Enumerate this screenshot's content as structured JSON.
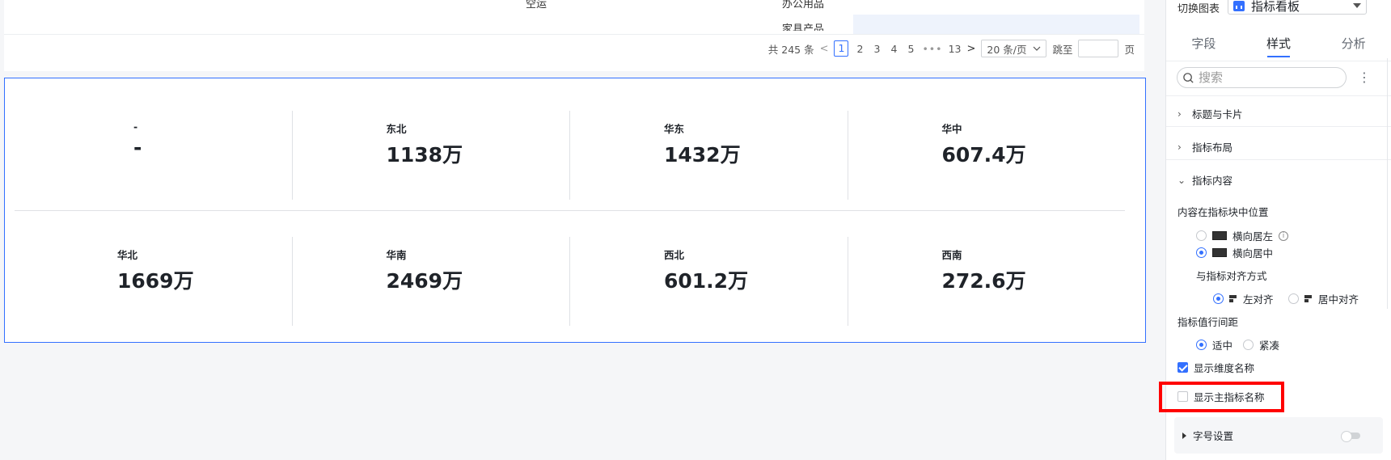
{
  "table": {
    "cut_cell_left": "空运",
    "cut_cell_right_1": "办公用品",
    "cut_cell_right_2": "家具产品"
  },
  "pagination": {
    "total": "共 245 条",
    "prev": "<",
    "pages": [
      "1",
      "2",
      "3",
      "4",
      "5"
    ],
    "ellipsis": "•••",
    "last_page": "13",
    "next": ">",
    "page_size": "20 条/页",
    "jump_label": "跳至",
    "jump_value": "",
    "page_suffix": "页"
  },
  "kpi": {
    "row1": [
      {
        "name": "-",
        "value": "-"
      },
      {
        "name": "东北",
        "value": "1138万"
      },
      {
        "name": "华东",
        "value": "1432万"
      },
      {
        "name": "华中",
        "value": "607.4万"
      }
    ],
    "row2": [
      {
        "name": "华北",
        "value": "1669万"
      },
      {
        "name": "华南",
        "value": "2469万"
      },
      {
        "name": "西北",
        "value": "601.2万"
      },
      {
        "name": "西南",
        "value": "272.6万"
      }
    ]
  },
  "panel": {
    "switch_chart_label": "切换图表",
    "chart_type": "指标看板",
    "tabs": [
      "字段",
      "样式",
      "分析"
    ],
    "active_tab": "样式",
    "search_placeholder": "搜索",
    "more": "⋮",
    "sections": {
      "title_card": "标题与卡片",
      "layout": "指标布局",
      "content": "指标内容"
    },
    "position_label": "内容在指标块中位置",
    "position_options": [
      "横向居左",
      "横向居中"
    ],
    "align_label": "与指标对齐方式",
    "align_options": [
      "左对齐",
      "居中对齐"
    ],
    "spacing_label": "指标值行间距",
    "spacing_options": [
      "适中",
      "紧凑"
    ],
    "show_dim_name": "显示维度名称",
    "show_main_metric_name": "显示主指标名称",
    "font_settings": "字号设置"
  },
  "colors": {
    "accent": "#3370ff",
    "highlight": "#ff0000"
  }
}
